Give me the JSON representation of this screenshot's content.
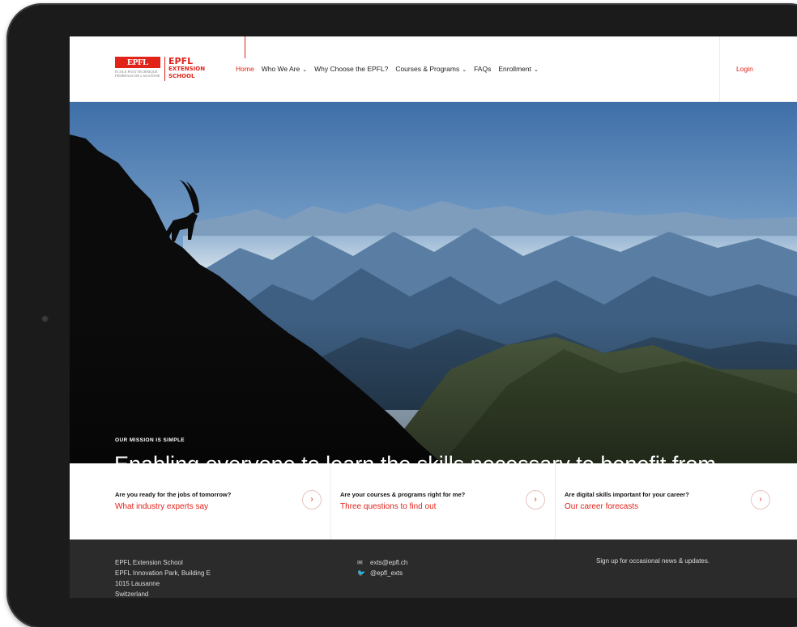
{
  "brand": {
    "mark": "EPFL",
    "mark_sub": "ÉCOLE POLYTECHNIQUE FÉDÉRALE DE LAUSANNE",
    "name_line1": "EPFL",
    "name_line2": "EXTENSION",
    "name_line3": "SCHOOL",
    "accent": "#e2231a"
  },
  "nav": {
    "items": [
      {
        "label": "Home",
        "dropdown": false,
        "active": true
      },
      {
        "label": "Who We Are",
        "dropdown": true
      },
      {
        "label": "Why Choose the EPFL?",
        "dropdown": false
      },
      {
        "label": "Courses & Programs",
        "dropdown": true
      },
      {
        "label": "FAQs",
        "dropdown": false
      },
      {
        "label": "Enrollment",
        "dropdown": true
      }
    ],
    "chevron": "⌄",
    "login": "Login"
  },
  "hero": {
    "kicker": "OUR MISSION IS SIMPLE",
    "headline": "Enabling everyone to learn the skills necessary to benefit from the opportunities of the digital age"
  },
  "cards": [
    {
      "question": "Are you ready for the jobs of tomorrow?",
      "link": "What industry experts say",
      "arrow": "›"
    },
    {
      "question": "Are your courses & programs right for me?",
      "link": "Three questions to find out",
      "arrow": "›"
    },
    {
      "question": "Are digital skills important for your career?",
      "link": "Our career forecasts",
      "arrow": "›"
    }
  ],
  "footer": {
    "address": [
      "EPFL Extension School",
      "EPFL Innovation Park, Building E",
      "1015 Lausanne",
      "Switzerland"
    ],
    "email": "exts@epfl.ch",
    "twitter": "@epfl_exts",
    "signup": "Sign up for occasional news & updates."
  }
}
